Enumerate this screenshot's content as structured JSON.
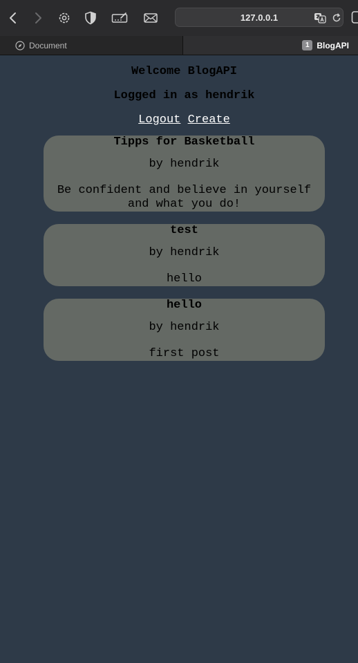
{
  "browser": {
    "url": "127.0.0.1",
    "tabs": [
      {
        "label": "Document",
        "active": false
      },
      {
        "label": "BlogAPI",
        "active": true,
        "badge": "1"
      }
    ],
    "toolbar_icons": [
      "back-icon",
      "forward-icon",
      "gear-icon",
      "shield-icon",
      "signature-icon",
      "mail-icon",
      "translate-icon",
      "reload-icon",
      "tabs-overview-icon"
    ]
  },
  "header": {
    "welcome": "Welcome BlogAPI",
    "logged_in": "Logged in as hendrik",
    "logout_label": "Logout",
    "create_label": "Create"
  },
  "posts": [
    {
      "title": "Tipps for Basketball",
      "author": "by hendrik",
      "body": "Be confident and believe in yourself and what you do!"
    },
    {
      "title": "test",
      "author": "by hendrik",
      "body": "hello"
    },
    {
      "title": "hello",
      "author": "by hendrik",
      "body": "first post"
    }
  ],
  "colors": {
    "page_background": "#2e3a48",
    "post_card": "#646964",
    "link": "#ffffff",
    "chrome_toolbar": "#2b2b2d"
  }
}
